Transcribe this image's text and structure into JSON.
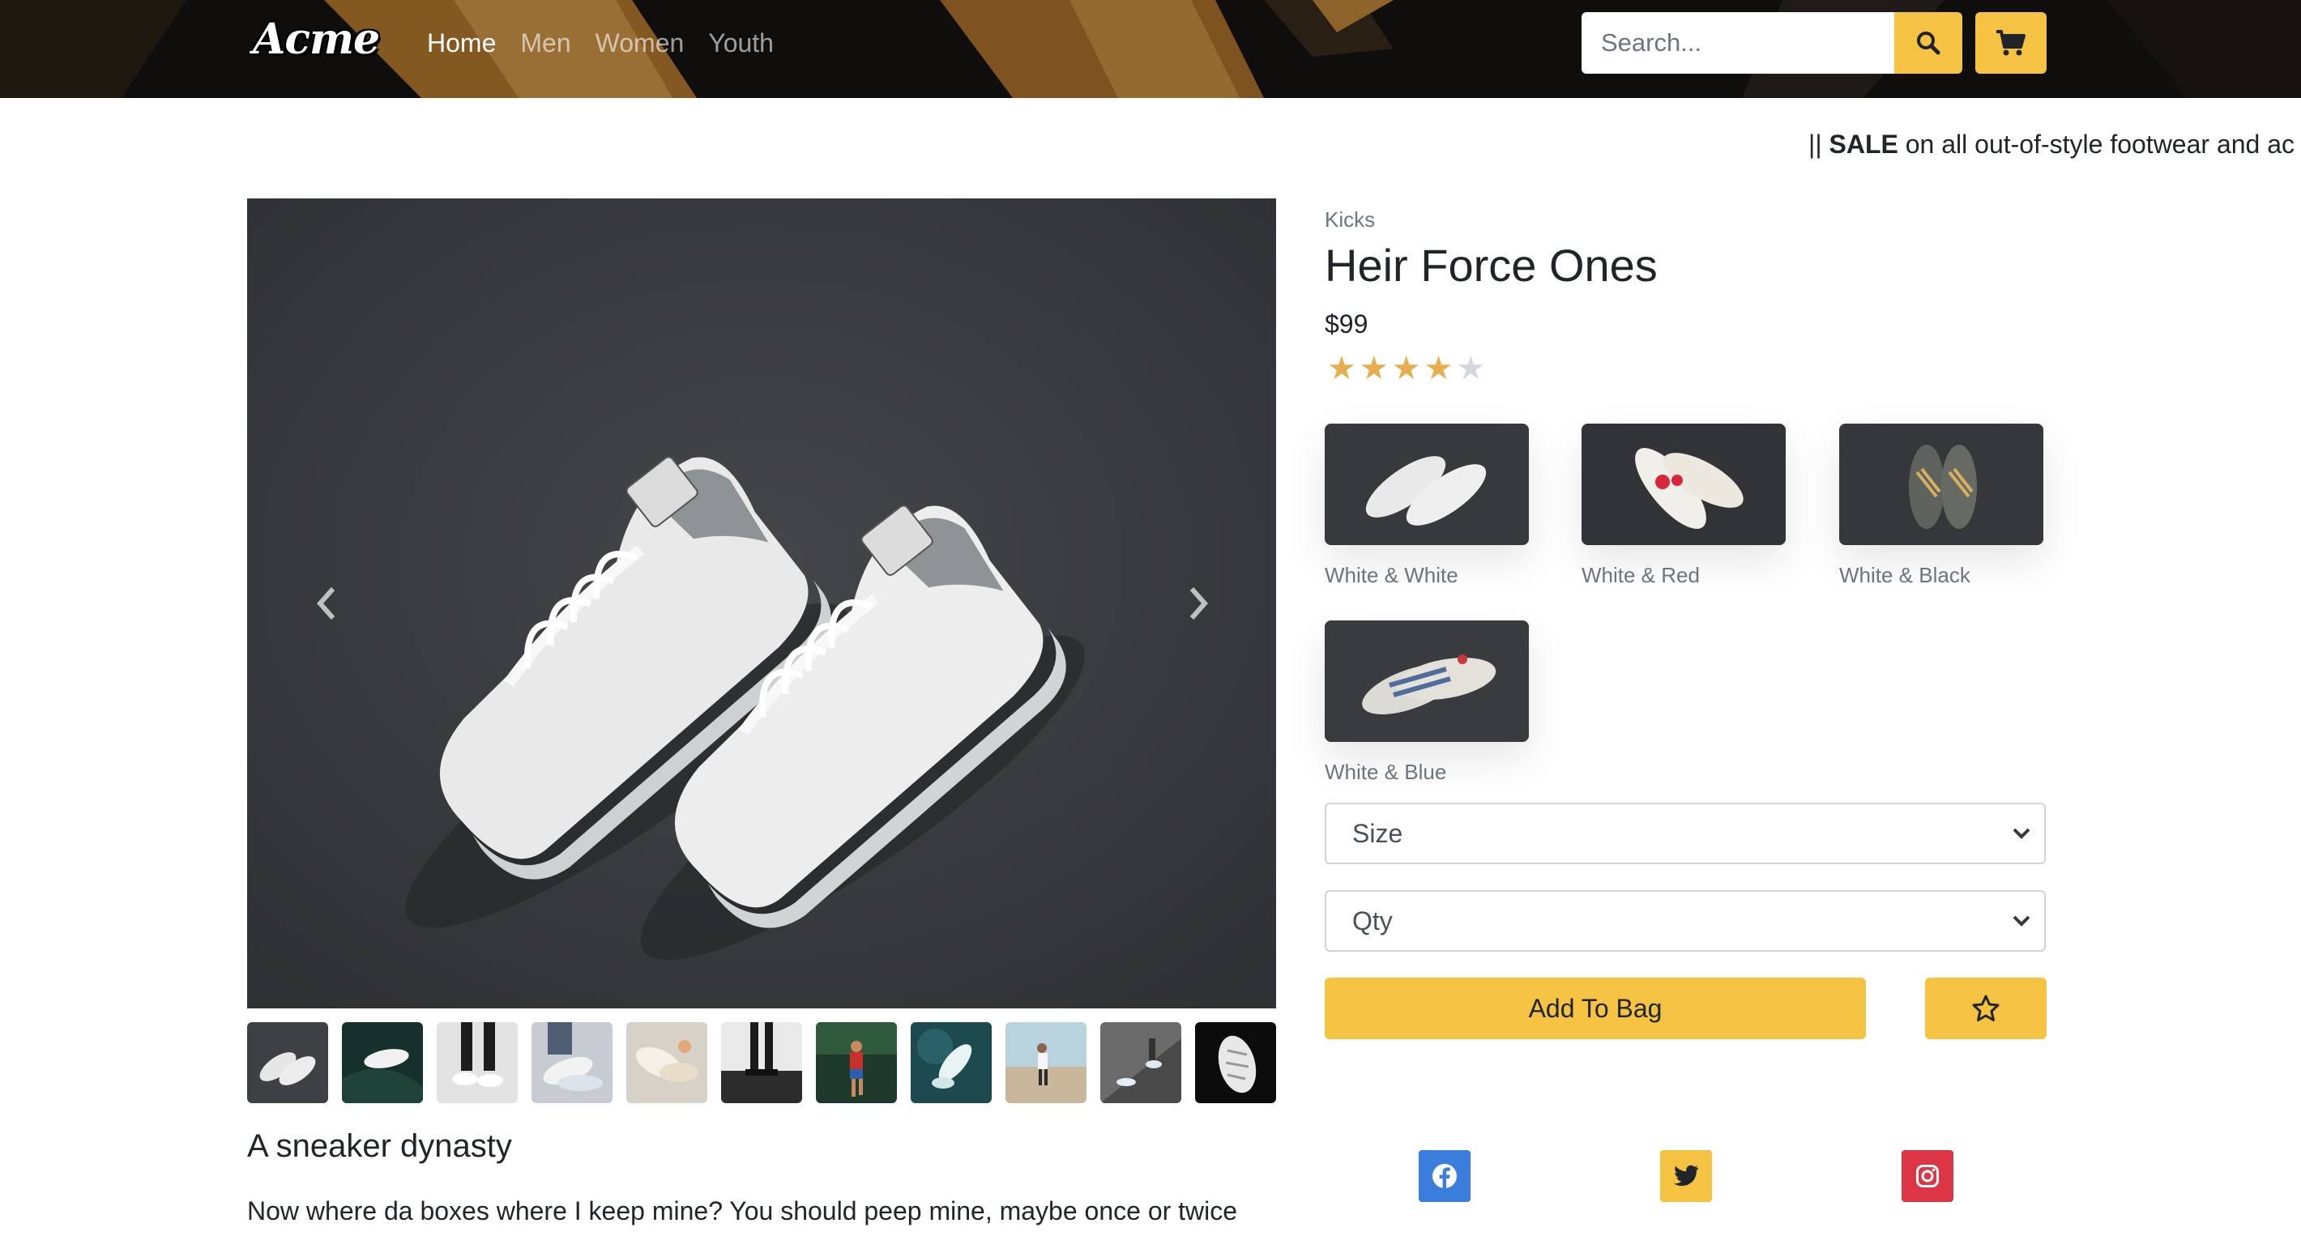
{
  "header": {
    "logo": "Acme",
    "nav": [
      {
        "label": "Home",
        "active": true
      },
      {
        "label": "Men",
        "active": false
      },
      {
        "label": "Women",
        "active": false
      },
      {
        "label": "Youth",
        "active": false
      }
    ],
    "search_placeholder": "Search...",
    "search_icon": "search-icon",
    "cart_icon": "cart-icon",
    "accent_color": "#f5c241"
  },
  "marquee": {
    "prefix": "|| ",
    "bold": "SALE",
    "text": " on all out-of-style footwear and ac"
  },
  "gallery": {
    "prev_icon": "chevron-left-icon",
    "next_icon": "chevron-right-icon",
    "thumb_count": 11
  },
  "product": {
    "category": "Kicks",
    "title": "Heir Force Ones",
    "price": "$99",
    "rating": 4,
    "rating_max": 5,
    "star_color": "#e8ad4e",
    "variants": [
      {
        "label": "White & White"
      },
      {
        "label": "White & Red"
      },
      {
        "label": "White & Black"
      },
      {
        "label": "White & Blue"
      }
    ],
    "size_select": "Size",
    "qty_select": "Qty",
    "add_to_bag": "Add To Bag",
    "favorite_icon": "star-outline-icon"
  },
  "story": {
    "title": "A sneaker dynasty",
    "text": "Now where da boxes where I keep mine? You should peep mine, maybe once or twice"
  },
  "social": [
    {
      "name": "facebook-icon",
      "color": "#3b7ddd"
    },
    {
      "name": "twitter-icon",
      "color": "#f5c241"
    },
    {
      "name": "instagram-icon",
      "color": "#dc3545"
    }
  ]
}
